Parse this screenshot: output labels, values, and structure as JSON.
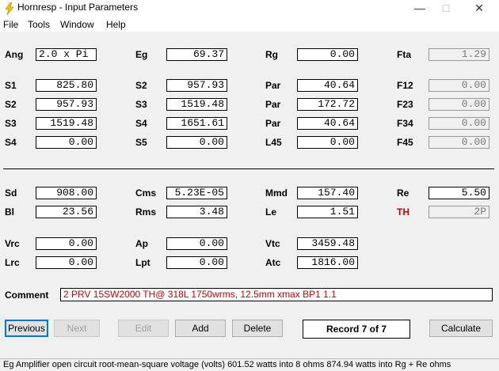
{
  "window": {
    "title": "Hornresp - Input Parameters"
  },
  "menu": [
    "File",
    "Tools",
    "Window",
    "Help"
  ],
  "params": {
    "Ang": "2.0 x Pi",
    "Eg": "69.37",
    "Rg": "0.00",
    "Fta": "1.29",
    "S1": "825.80",
    "S2": "957.93",
    "Par1": "40.64",
    "F12": "0.00",
    "S2b": "957.93",
    "S3": "1519.48",
    "Par2": "172.72",
    "F23": "0.00",
    "S3b": "1519.48",
    "S4": "1651.61",
    "Par3": "40.64",
    "F34": "0.00",
    "S4b": "0.00",
    "S5": "0.00",
    "L45": "0.00",
    "F45": "0.00",
    "Sd": "908.00",
    "Cms": "5.23E-05",
    "Mmd": "157.40",
    "Re": "5.50",
    "Bl": "23.56",
    "Rms": "3.48",
    "Le": "1.51",
    "TH": "2P",
    "Vrc": "0.00",
    "Ap": "0.00",
    "Vtc": "3459.48",
    "Lrc": "0.00",
    "Lpt": "0.00",
    "Atc": "1816.00"
  },
  "labels": {
    "Ang": "Ang",
    "Eg": "Eg",
    "Rg": "Rg",
    "Fta": "Fta",
    "S1": "S1",
    "S2": "S2",
    "Par": "Par",
    "F12": "F12",
    "S3": "S3",
    "F23": "F23",
    "S4": "S4",
    "F34": "F34",
    "S5": "S5",
    "L45": "L45",
    "F45": "F45",
    "Sd": "Sd",
    "Cms": "Cms",
    "Mmd": "Mmd",
    "Re": "Re",
    "Bl": "Bl",
    "Rms": "Rms",
    "Le": "Le",
    "TH": "TH",
    "Vrc": "Vrc",
    "Ap": "Ap",
    "Vtc": "Vtc",
    "Lrc": "Lrc",
    "Lpt": "Lpt",
    "Atc": "Atc",
    "Comment": "Comment"
  },
  "comment": "2 PRV 15SW2000  TH@ 318L 1750wrms, 12.5mm xmax BP1  1.1",
  "buttons": {
    "previous": "Previous",
    "next": "Next",
    "edit": "Edit",
    "add": "Add",
    "delete": "Delete",
    "calculate": "Calculate"
  },
  "record": "Record 7 of 7",
  "status": "Eg   Amplifier open circuit root-mean-square voltage  (volts)   601.52 watts into 8 ohms    874.94 watts into Rg + Re ohms",
  "colors": {
    "accent_red": "#cc0000",
    "focus_blue": "#0078d7"
  }
}
